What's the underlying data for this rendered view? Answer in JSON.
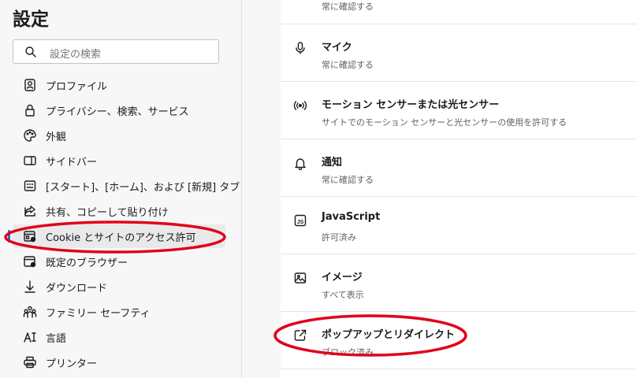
{
  "sidebar": {
    "title": "設定",
    "search_placeholder": "設定の検索",
    "items": [
      {
        "label": "プロファイル",
        "icon": "profile-icon"
      },
      {
        "label": "プライバシー、検索、サービス",
        "icon": "lock-icon"
      },
      {
        "label": "外観",
        "icon": "palette-icon"
      },
      {
        "label": "サイドバー",
        "icon": "sidebar-icon"
      },
      {
        "label": "[スタート]、[ホーム]、および [新規] タブ",
        "icon": "home-grid-icon"
      },
      {
        "label": "共有、コピーして貼り付け",
        "icon": "share-icon"
      },
      {
        "label": "Cookie とサイトのアクセス許可",
        "icon": "site-permissions-icon"
      },
      {
        "label": "既定のブラウザー",
        "icon": "default-browser-icon"
      },
      {
        "label": "ダウンロード",
        "icon": "download-icon"
      },
      {
        "label": "ファミリー セーフティ",
        "icon": "family-icon"
      },
      {
        "label": "言語",
        "icon": "language-icon"
      },
      {
        "label": "プリンター",
        "icon": "printer-icon"
      }
    ]
  },
  "main": {
    "top_subtitle": "常に確認する",
    "rows": [
      {
        "title": "マイク",
        "subtitle": "常に確認する",
        "icon": "microphone-icon"
      },
      {
        "title": "モーション センサーまたは光センサー",
        "subtitle": "サイトでのモーション センサーと光センサーの使用を許可する",
        "icon": "motion-sensor-icon"
      },
      {
        "title": "通知",
        "subtitle": "常に確認する",
        "icon": "bell-icon"
      },
      {
        "title": "JavaScript",
        "subtitle": "許可済み",
        "icon": "javascript-icon"
      },
      {
        "title": "イメージ",
        "subtitle": "すべて表示",
        "icon": "image-icon"
      },
      {
        "title": "ポップアップとリダイレクト",
        "subtitle": "ブロック済み",
        "icon": "popup-icon"
      }
    ]
  },
  "colors": {
    "accent": "#2b6bcf",
    "annotation": "#e0001b"
  }
}
